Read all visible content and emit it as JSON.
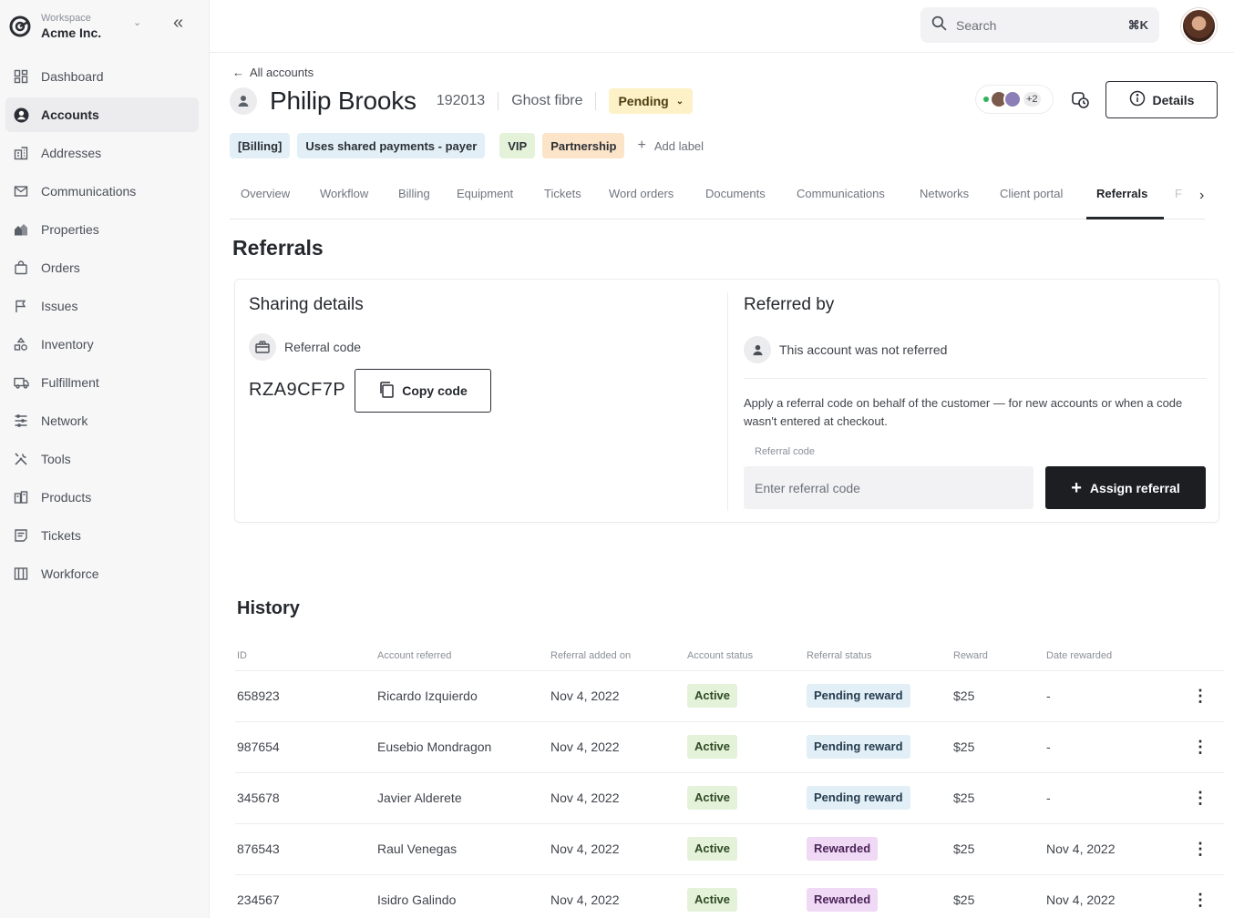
{
  "workspace": {
    "small_label": "Workspace",
    "name": "Acme Inc."
  },
  "sidebar": {
    "items": [
      {
        "label": "Dashboard"
      },
      {
        "label": "Accounts"
      },
      {
        "label": "Addresses"
      },
      {
        "label": "Communications"
      },
      {
        "label": "Properties"
      },
      {
        "label": "Orders"
      },
      {
        "label": "Issues"
      },
      {
        "label": "Inventory"
      },
      {
        "label": "Fulfillment"
      },
      {
        "label": "Network"
      },
      {
        "label": "Tools"
      },
      {
        "label": "Products"
      },
      {
        "label": "Tickets"
      },
      {
        "label": "Workforce"
      }
    ],
    "active_index": 1
  },
  "topbar": {
    "search_placeholder": "Search",
    "shortcut": "⌘K"
  },
  "breadcrumb": {
    "back_label": "All accounts"
  },
  "account": {
    "name": "Philip Brooks",
    "number": "192013",
    "plan": "Ghost fibre",
    "status": "Pending",
    "members_extra": "+2",
    "details_label": "Details"
  },
  "tags": {
    "billing": "[Billing]",
    "shared": "Uses shared payments - payer",
    "vip": "VIP",
    "partnership": "Partnership",
    "add_label": "Add label"
  },
  "tabs": [
    {
      "label": "Overview"
    },
    {
      "label": "Workflow"
    },
    {
      "label": "Billing"
    },
    {
      "label": "Equipment"
    },
    {
      "label": "Tickets"
    },
    {
      "label": "Word orders"
    },
    {
      "label": "Documents"
    },
    {
      "label": "Communications"
    },
    {
      "label": "Networks"
    },
    {
      "label": "Client portal"
    },
    {
      "label": "Referrals"
    },
    {
      "label": "F"
    }
  ],
  "active_tab": "Referrals",
  "referrals": {
    "title": "Referrals",
    "sharing": {
      "title": "Sharing details",
      "code_label": "Referral code",
      "code": "RZA9CF7P",
      "copy_label": "Copy code"
    },
    "referred_by": {
      "title": "Referred by",
      "status_text": "This account was not referred",
      "description": "Apply a referral code on behalf of the customer — for new accounts or when a code wasn't entered at checkout.",
      "field_label": "Referral code",
      "field_placeholder": "Enter referral code",
      "assign_label": "Assign referral"
    }
  },
  "history": {
    "title": "History",
    "columns": [
      "ID",
      "Account referred",
      "Referral added on",
      "Account status",
      "Referral status",
      "Reward",
      "Date rewarded"
    ],
    "rows": [
      {
        "id": "658923",
        "account": "Ricardo Izquierdo",
        "added": "Nov 4, 2022",
        "account_status": "Active",
        "referral_status": "Pending reward",
        "reward": "$25",
        "date_rewarded": "-"
      },
      {
        "id": "987654",
        "account": "Eusebio Mondragon",
        "added": "Nov 4, 2022",
        "account_status": "Active",
        "referral_status": "Pending reward",
        "reward": "$25",
        "date_rewarded": "-"
      },
      {
        "id": "345678",
        "account": "Javier Alderete",
        "added": "Nov 4, 2022",
        "account_status": "Active",
        "referral_status": "Pending reward",
        "reward": "$25",
        "date_rewarded": "-"
      },
      {
        "id": "876543",
        "account": "Raul Venegas",
        "added": "Nov 4, 2022",
        "account_status": "Active",
        "referral_status": "Rewarded",
        "reward": "$25",
        "date_rewarded": "Nov 4, 2022"
      },
      {
        "id": "234567",
        "account": "Isidro Galindo",
        "added": "Nov 4, 2022",
        "account_status": "Active",
        "referral_status": "Rewarded",
        "reward": "$25",
        "date_rewarded": "Nov 4, 2022"
      }
    ]
  },
  "colors": {
    "status_active_bg": "#e4f2d9",
    "status_pending_reward_bg": "#e2eff7",
    "status_rewarded_bg": "#efd9f5",
    "pending_badge_bg": "#fdf1c7",
    "primary_button_bg": "#1c1e22"
  }
}
